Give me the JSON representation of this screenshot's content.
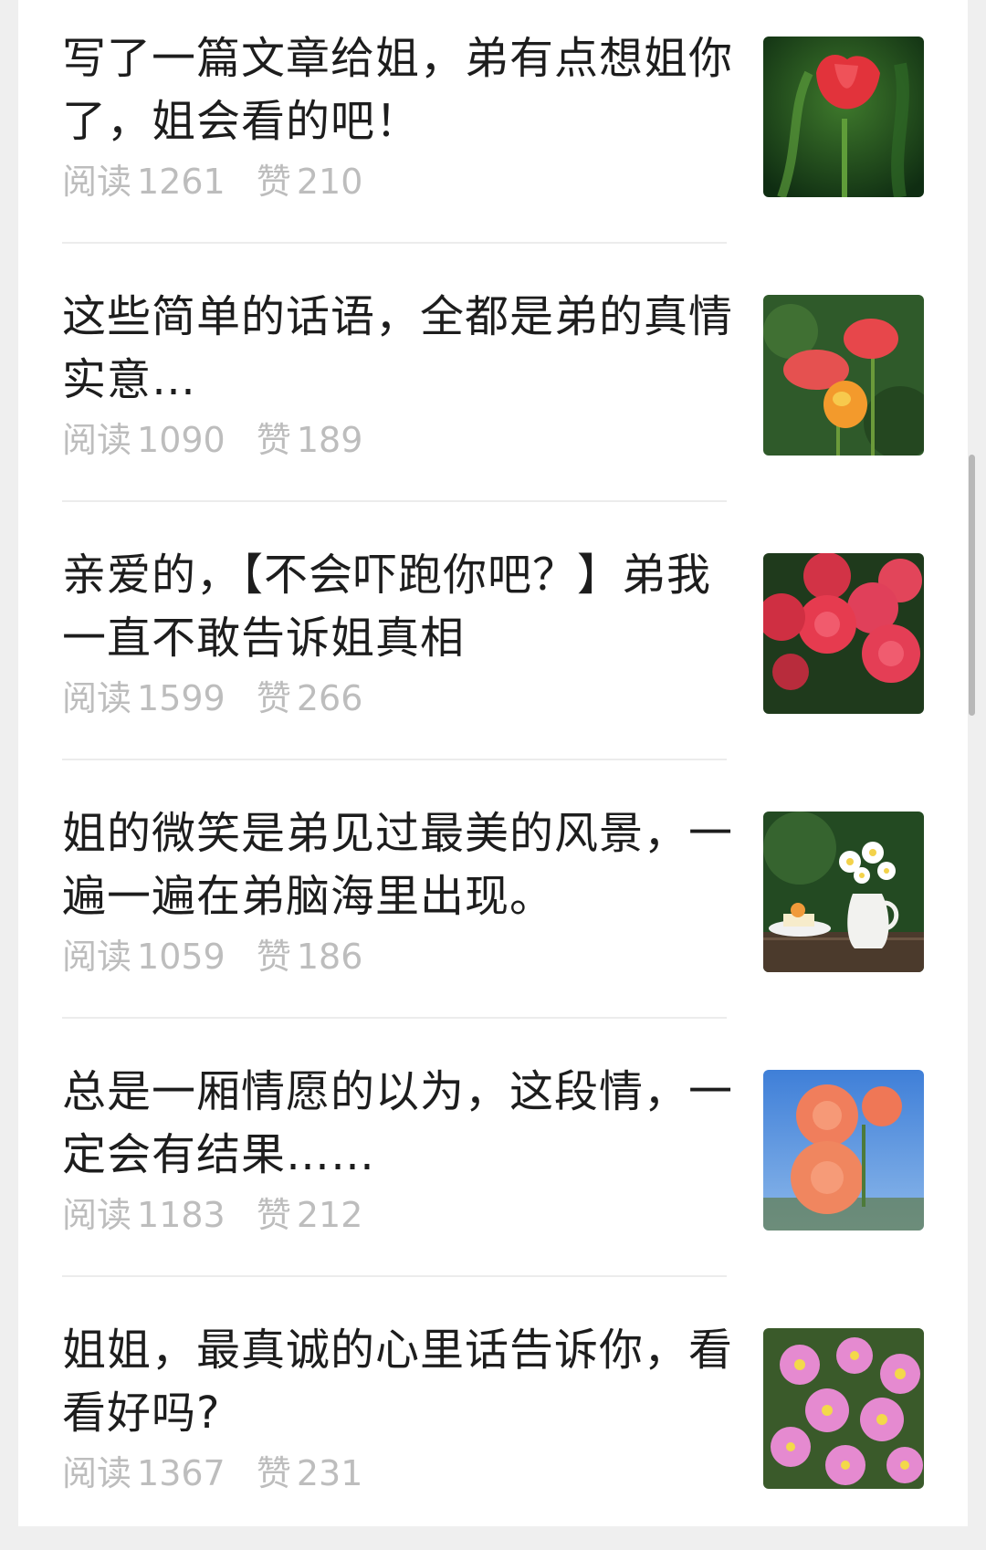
{
  "articles": [
    {
      "title": "写了一篇文章给姐，弟有点想姐你了，姐会看的吧！",
      "reads_label": "阅读",
      "reads": "1261",
      "likes_label": "赞",
      "likes": "210",
      "thumb": "red-tulip-image"
    },
    {
      "title": "这些简单的话语，全都是弟的真情实意…",
      "reads_label": "阅读",
      "reads": "1090",
      "likes_label": "赞",
      "likes": "189",
      "thumb": "poppies-image"
    },
    {
      "title": "亲爱的，【不会吓跑你吧？】弟我一直不敢告诉姐真相",
      "reads_label": "阅读",
      "reads": "1599",
      "likes_label": "赞",
      "likes": "266",
      "thumb": "red-roses-image"
    },
    {
      "title": "姐的微笑是弟见过最美的风景，一遍一遍在弟脑海里出现。",
      "reads_label": "阅读",
      "reads": "1059",
      "likes_label": "赞",
      "likes": "186",
      "thumb": "daisy-vase-table-image"
    },
    {
      "title": "总是一厢情愿的以为，这段情，一定会有结果……",
      "reads_label": "阅读",
      "reads": "1183",
      "likes_label": "赞",
      "likes": "212",
      "thumb": "carnations-sky-image"
    },
    {
      "title": "姐姐，最真诚的心里话告诉你，看看好吗?",
      "reads_label": "阅读",
      "reads": "1367",
      "likes_label": "赞",
      "likes": "231",
      "thumb": "pink-asters-image"
    }
  ],
  "colors": {
    "title": "#1d1d1d",
    "meta": "#bdbdbd",
    "divider": "#ececec"
  }
}
